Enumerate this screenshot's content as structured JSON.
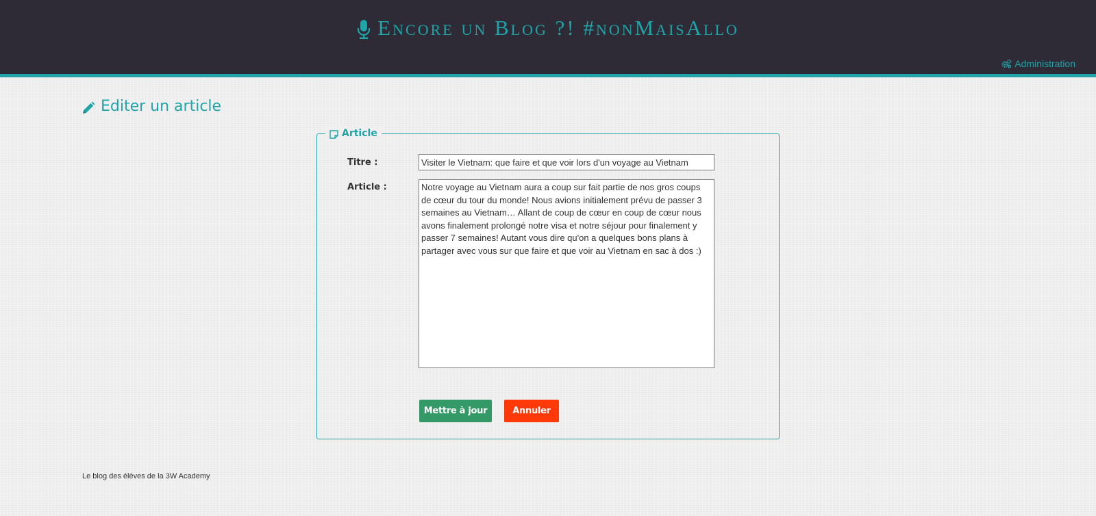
{
  "header": {
    "site_title": "Encore un Blog ?! #nonMaisAllo",
    "title_icon": "microphone-icon",
    "admin_label": "Administration",
    "admin_icon": "gears-icon",
    "accent_color": "#1fa4a8",
    "background_color": "#2e2a36"
  },
  "page": {
    "title": "Editer un article",
    "title_icon": "pencil-icon"
  },
  "form": {
    "legend": "Article",
    "legend_icon": "note-icon",
    "title_label": "Titre :",
    "title_value": "Visiter le Vietnam: que faire et que voir lors d'un voyage au Vietnam",
    "article_label": "Article :",
    "article_value": "Notre voyage au Vietnam aura a coup sur fait partie de nos gros coups de cœur du tour du monde! Nous avions initialement prévu de passer 3 semaines au Vietnam… Allant de coup de cœur en coup de cœur nous avons finalement prolongé notre visa et notre séjour pour finalement y passer 7 semaines! Autant vous dire qu'on a quelques bons plans à partager avec vous sur que faire et que voir au Vietnam en sac à dos :)",
    "update_button": "Mettre à jour",
    "cancel_button": "Annuler",
    "update_color": "#339966",
    "cancel_color": "#ff3a08"
  },
  "footer": {
    "text": "Le blog des élèves de la 3W Academy"
  }
}
